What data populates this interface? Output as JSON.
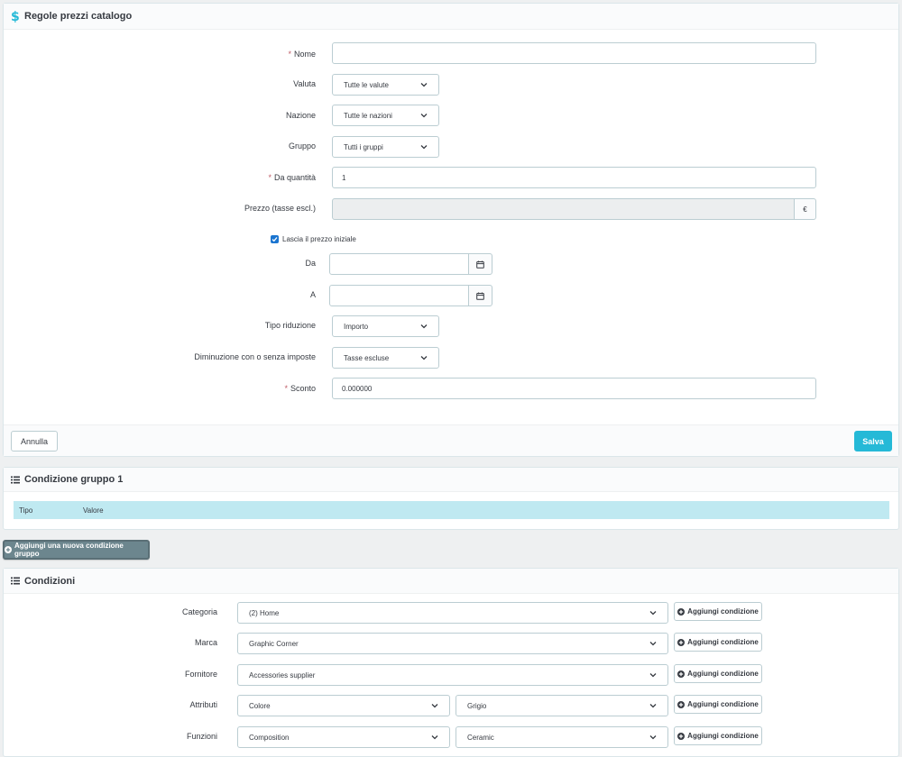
{
  "rules_panel": {
    "title": "Regole prezzi catalogo",
    "fields": {
      "nome": {
        "label": "Nome",
        "required": true,
        "value": ""
      },
      "valuta": {
        "label": "Valuta",
        "selected": "Tutte le valute"
      },
      "nazione": {
        "label": "Nazione",
        "selected": "Tutte le nazioni"
      },
      "gruppo": {
        "label": "Gruppo",
        "selected": "Tutti i gruppi"
      },
      "da_quantita": {
        "label": "Da quantità",
        "required": true,
        "value": "1"
      },
      "prezzo": {
        "label": "Prezzo (tasse escl.)",
        "value": "",
        "currency": "€"
      },
      "lascia_prezzo": {
        "label": "Lascia il prezzo iniziale",
        "checked": true
      },
      "da": {
        "label": "Da",
        "value": ""
      },
      "a": {
        "label": "A",
        "value": ""
      },
      "tipo_riduzione": {
        "label": "Tipo riduzione",
        "selected": "Importo"
      },
      "diminuzione": {
        "label": "Diminuzione con o senza imposte",
        "selected": "Tasse escluse"
      },
      "sconto": {
        "label": "Sconto",
        "required": true,
        "value": "0.000000"
      }
    },
    "cancel_label": "Annulla",
    "save_label": "Salva"
  },
  "group_panel": {
    "title": "Condizione gruppo 1",
    "columns": [
      "Tipo",
      "Valore"
    ]
  },
  "add_group_label": "Aggiungi una nuova condizione gruppo",
  "conditions_panel": {
    "title": "Condizioni",
    "add_label": "Aggiungi condizione",
    "rows": [
      {
        "label": "Categoria",
        "values": [
          "(2) Home"
        ]
      },
      {
        "label": "Marca",
        "values": [
          "Graphic Corner"
        ]
      },
      {
        "label": "Fornitore",
        "values": [
          "Accessories supplier"
        ]
      },
      {
        "label": "Attributi",
        "values": [
          "Colore",
          "Grigio"
        ]
      },
      {
        "label": "Funzioni",
        "values": [
          "Composition",
          "Ceramic"
        ]
      }
    ]
  },
  "colors": {
    "primary": "#25b9d7",
    "header_bar": "#bfe9f1",
    "dark_button": "#6c868e",
    "required": "#c05c67",
    "checkbox": "#1b75d0"
  },
  "icons": {
    "title": "dollar-icon",
    "list": "list-icon",
    "calendar": "calendar-icon",
    "add": "plus-circle-icon",
    "dropdown": "chevron-down-icon"
  }
}
